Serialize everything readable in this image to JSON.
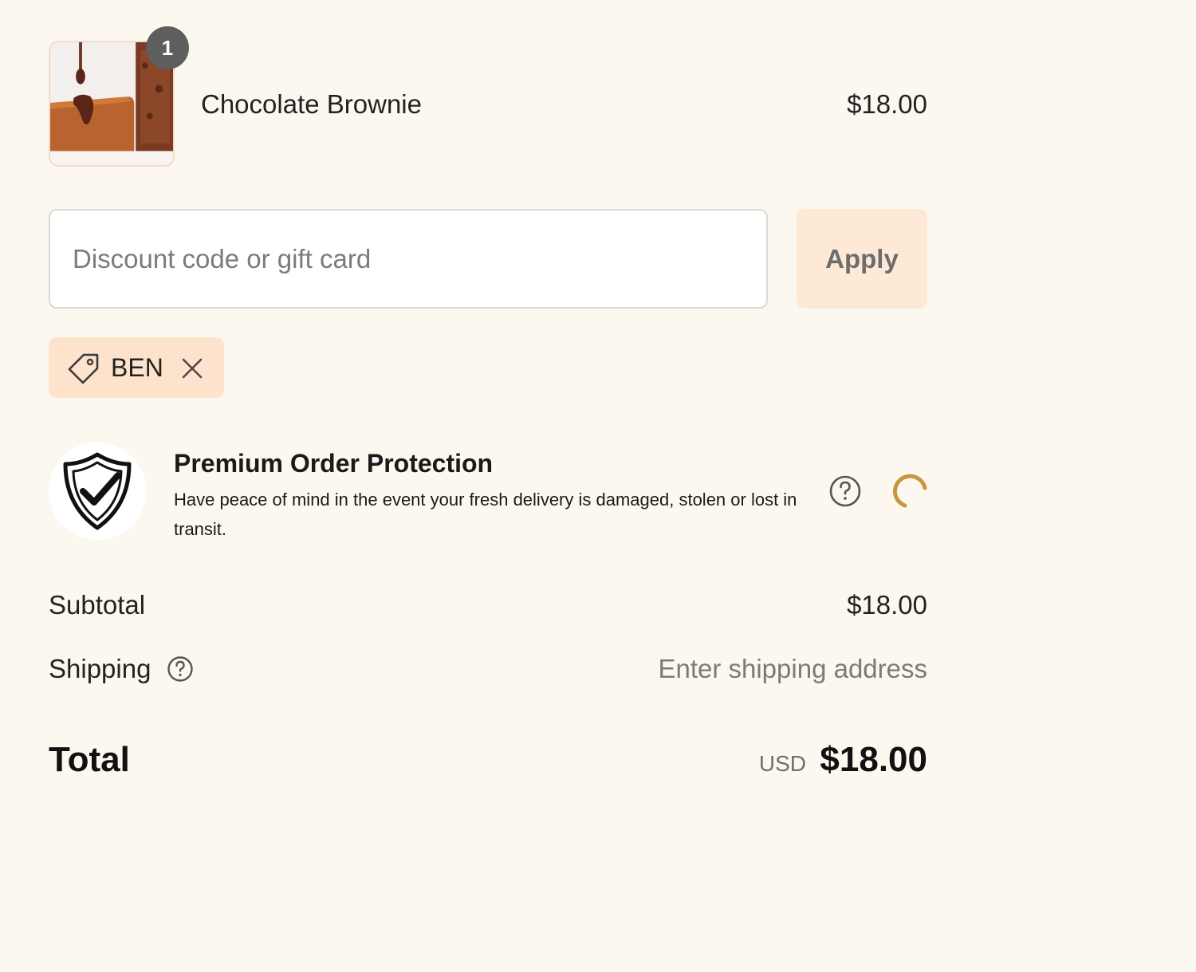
{
  "line_item": {
    "quantity": "1",
    "name": "Chocolate Brownie",
    "price": "$18.00",
    "image_icon": "brownie-product-image"
  },
  "discount": {
    "placeholder": "Discount code or gift card",
    "value": "",
    "apply_label": "Apply"
  },
  "applied_code": {
    "code": "BEN",
    "icon": "tag-icon",
    "remove_icon": "close-icon"
  },
  "protection": {
    "title": "Premium Order Protection",
    "description": "Have peace of mind in the event your fresh delivery is damaged, stolen or lost in transit.",
    "icon": "shield-check-icon",
    "help_icon": "question-icon",
    "loading_icon": "spinner-icon"
  },
  "totals": {
    "subtotal_label": "Subtotal",
    "subtotal_value": "$18.00",
    "shipping_label": "Shipping",
    "shipping_value": "Enter shipping address",
    "total_label": "Total",
    "total_currency": "USD",
    "total_value": "$18.00"
  },
  "colors": {
    "background": "#fdf8ef",
    "accent_soft": "#fde9d5",
    "tag_background": "#fde3cc",
    "spinner": "#c8963e"
  }
}
